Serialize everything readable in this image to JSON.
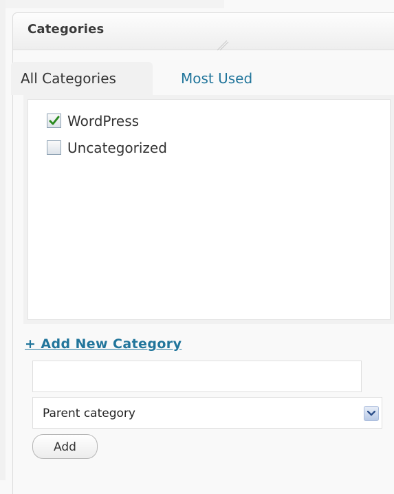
{
  "box": {
    "title": "Categories"
  },
  "tabs": {
    "all": "All Categories",
    "popular": "Most Used"
  },
  "categories": [
    {
      "label": "WordPress",
      "checked": true
    },
    {
      "label": "Uncategorized",
      "checked": false
    }
  ],
  "add_new": {
    "link_label": "+ Add New Category",
    "name_value": "",
    "parent_selected": "Parent category",
    "add_button_label": "Add"
  },
  "colors": {
    "link": "#21759b",
    "check": "#2a8a1f"
  }
}
